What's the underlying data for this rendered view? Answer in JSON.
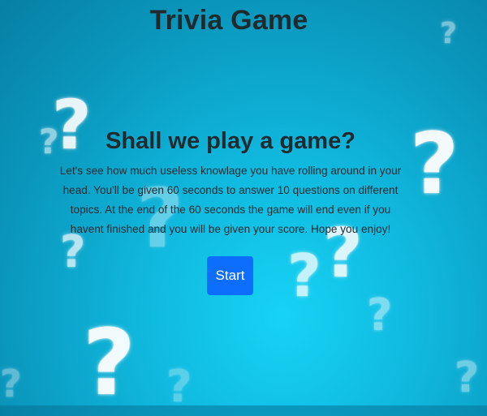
{
  "app": {
    "title": "Trivia Game"
  },
  "intro": {
    "heading": "Shall we play a game?",
    "description": "Let's see how much useless knowlage you have rolling around in your head. You'll be given 60 seconds to answer 10 questions on different topics. At the end of the 60 seconds the game will end even if you havent finished and you will be given your score. Hope you enjoy!"
  },
  "controls": {
    "start_label": "Start"
  },
  "background": {
    "glyph": "?",
    "icon": "question-mark-icon"
  },
  "colors": {
    "background_center": "#16d3f5",
    "background_edge": "#077fa3",
    "button": "#0d6efd",
    "text": "#1f2a2e"
  }
}
